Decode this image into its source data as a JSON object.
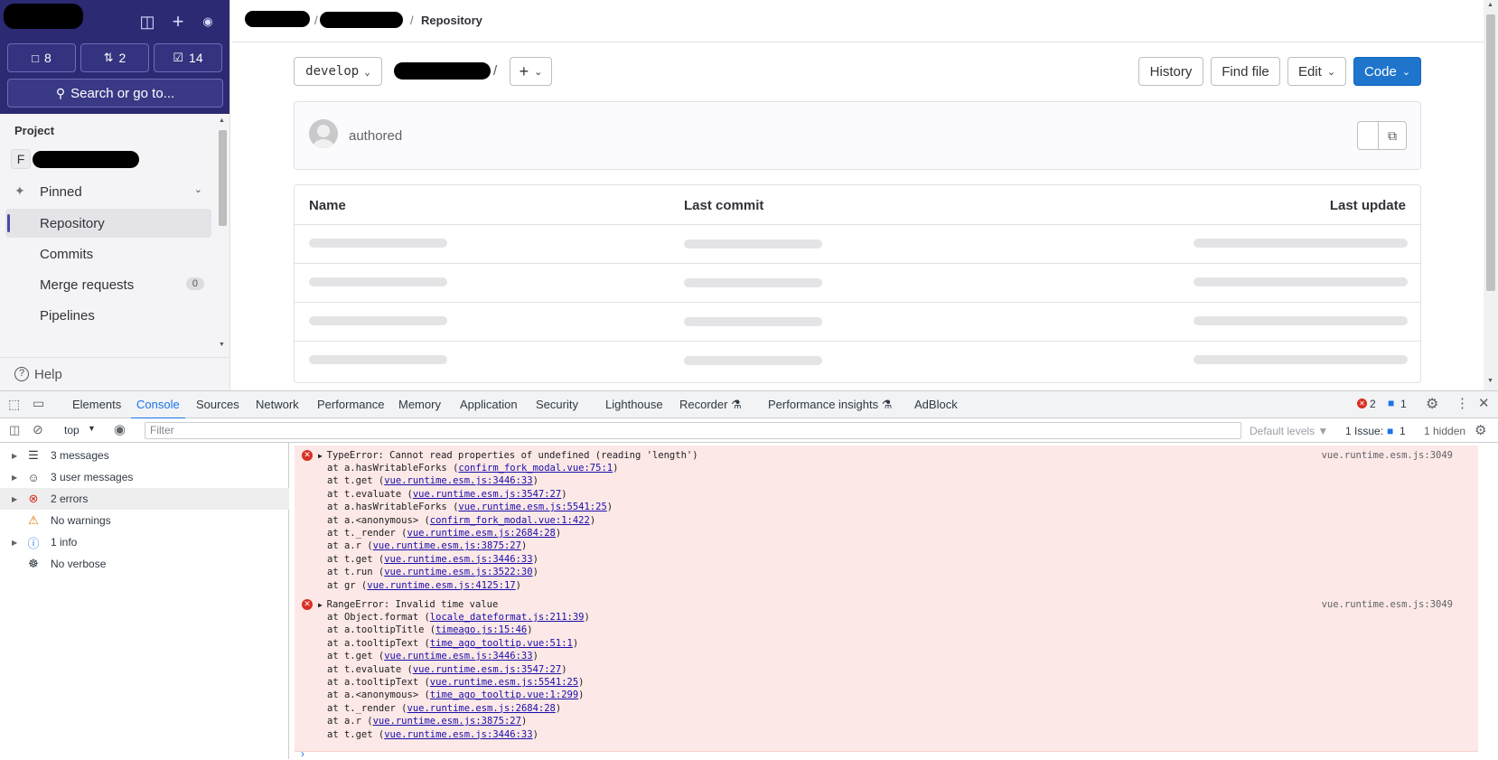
{
  "sidebar": {
    "counters": [
      {
        "icon": "issues-icon",
        "value": "8"
      },
      {
        "icon": "merge-request-icon",
        "value": "2"
      },
      {
        "icon": "todo-icon",
        "value": "14"
      }
    ],
    "search_label": "Search or go to...",
    "section_label": "Project",
    "project_initial": "F",
    "pinned_label": "Pinned",
    "items": [
      {
        "label": "Repository",
        "active": true
      },
      {
        "label": "Commits"
      },
      {
        "label": "Merge requests",
        "badge": "0"
      },
      {
        "label": "Pipelines"
      }
    ],
    "help_label": "Help"
  },
  "breadcrumb": {
    "current": "Repository"
  },
  "repo": {
    "branch": "develop",
    "path_sep": "/",
    "buttons": {
      "history": "History",
      "find_file": "Find file",
      "edit": "Edit",
      "code": "Code"
    },
    "commit_text": "authored",
    "table_headers": {
      "name": "Name",
      "last_commit": "Last commit",
      "last_update": "Last update"
    }
  },
  "devtools": {
    "tabs": [
      "Elements",
      "Console",
      "Sources",
      "Network",
      "Performance",
      "Memory",
      "Application",
      "Security",
      "Lighthouse",
      "Recorder",
      "Performance insights",
      "AdBlock"
    ],
    "active_tab": "Console",
    "error_count": "2",
    "message_count": "1",
    "context": "top",
    "filter_placeholder": "Filter",
    "default_levels": "Default levels",
    "issues_label": "1 Issue:",
    "issues_count": "1",
    "hidden_label": "1 hidden",
    "side_items": [
      {
        "label": "3 messages",
        "icon": "list-icon"
      },
      {
        "label": "3 user messages",
        "icon": "user-icon"
      },
      {
        "label": "2 errors",
        "icon": "error-icon"
      },
      {
        "label": "No warnings",
        "icon": "warning-icon"
      },
      {
        "label": "1 info",
        "icon": "info-icon"
      },
      {
        "label": "No verbose",
        "icon": "bug-icon"
      }
    ],
    "errors": [
      {
        "title": "TypeError: Cannot read properties of undefined (reading 'length')",
        "source": "vue.runtime.esm.js:3049",
        "stack": [
          {
            "pre": "at a.hasWritableForks (",
            "link": "confirm_fork_modal.vue:75:1",
            "post": ")"
          },
          {
            "pre": "at t.get (",
            "link": "vue.runtime.esm.js:3446:33",
            "post": ")"
          },
          {
            "pre": "at t.evaluate (",
            "link": "vue.runtime.esm.js:3547:27",
            "post": ")"
          },
          {
            "pre": "at a.hasWritableForks (",
            "link": "vue.runtime.esm.js:5541:25",
            "post": ")"
          },
          {
            "pre": "at a.<anonymous> (",
            "link": "confirm_fork_modal.vue:1:422",
            "post": ")"
          },
          {
            "pre": "at t._render (",
            "link": "vue.runtime.esm.js:2684:28",
            "post": ")"
          },
          {
            "pre": "at a.r (",
            "link": "vue.runtime.esm.js:3875:27",
            "post": ")"
          },
          {
            "pre": "at t.get (",
            "link": "vue.runtime.esm.js:3446:33",
            "post": ")"
          },
          {
            "pre": "at t.run (",
            "link": "vue.runtime.esm.js:3522:30",
            "post": ")"
          },
          {
            "pre": "at gr (",
            "link": "vue.runtime.esm.js:4125:17",
            "post": ")"
          }
        ]
      },
      {
        "title": "RangeError: Invalid time value",
        "source": "vue.runtime.esm.js:3049",
        "stack": [
          {
            "pre": "at Object.format (",
            "link": "locale_dateformat.js:211:39",
            "post": ")"
          },
          {
            "pre": "at a.tooltipTitle (",
            "link": "timeago.js:15:46",
            "post": ")"
          },
          {
            "pre": "at a.tooltipText (",
            "link": "time_ago_tooltip.vue:51:1",
            "post": ")"
          },
          {
            "pre": "at t.get (",
            "link": "vue.runtime.esm.js:3446:33",
            "post": ")"
          },
          {
            "pre": "at t.evaluate (",
            "link": "vue.runtime.esm.js:3547:27",
            "post": ")"
          },
          {
            "pre": "at a.tooltipText (",
            "link": "vue.runtime.esm.js:5541:25",
            "post": ")"
          },
          {
            "pre": "at a.<anonymous> (",
            "link": "time_ago_tooltip.vue:1:299",
            "post": ")"
          },
          {
            "pre": "at t._render (",
            "link": "vue.runtime.esm.js:2684:28",
            "post": ")"
          },
          {
            "pre": "at a.r (",
            "link": "vue.runtime.esm.js:3875:27",
            "post": ")"
          },
          {
            "pre": "at t.get (",
            "link": "vue.runtime.esm.js:3446:33",
            "post": ")"
          }
        ]
      }
    ]
  }
}
